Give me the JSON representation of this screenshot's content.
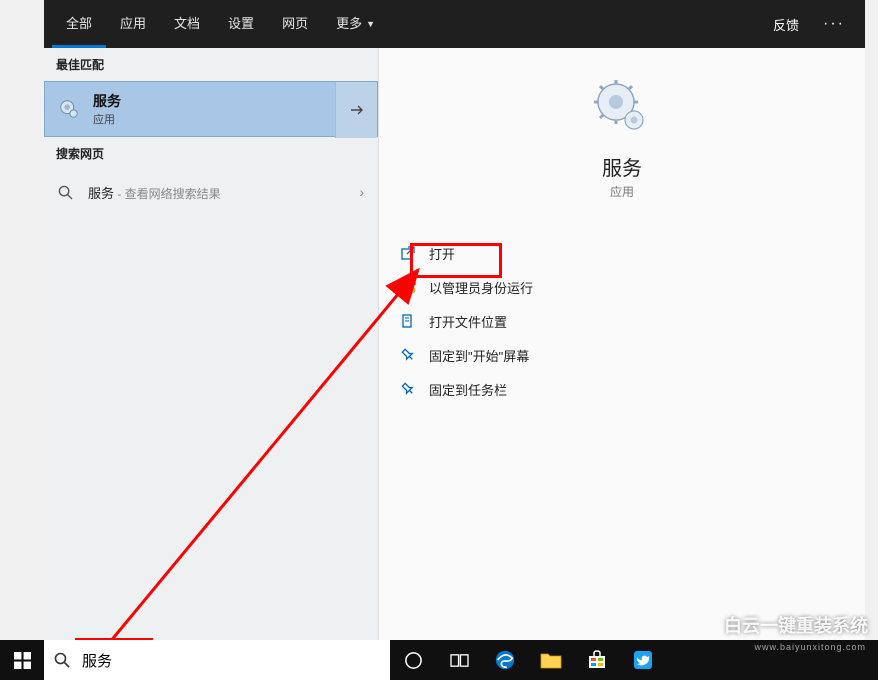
{
  "tabs": {
    "all": "全部",
    "apps": "应用",
    "docs": "文档",
    "settings": "设置",
    "web": "网页",
    "more": "更多",
    "feedback": "反馈"
  },
  "left": {
    "best_header": "最佳匹配",
    "best_title": "服务",
    "best_sub": "应用",
    "web_header": "搜索网页",
    "web_query": "服务",
    "web_hint": " - 查看网络搜索结果"
  },
  "right": {
    "app_name": "服务",
    "app_type": "应用",
    "actions": {
      "open": "打开",
      "admin": "以管理员身份运行",
      "location": "打开文件位置",
      "pin_start": "固定到\"开始\"屏幕",
      "pin_taskbar": "固定到任务栏"
    }
  },
  "search": {
    "value": "服务"
  },
  "watermark": {
    "main": "白云一键重装系统",
    "sub": "www.baiyunxitong.com"
  }
}
